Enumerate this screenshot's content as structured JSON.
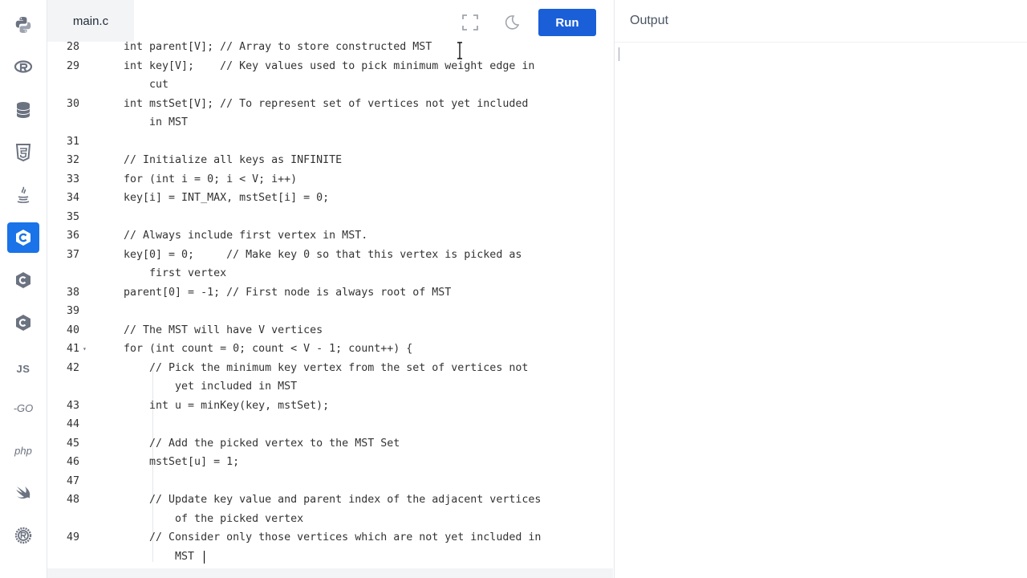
{
  "sidebar": {
    "items": [
      {
        "name": "python-icon",
        "label": ""
      },
      {
        "name": "r-icon",
        "label": ""
      },
      {
        "name": "database-icon",
        "label": ""
      },
      {
        "name": "html5-icon",
        "label": ""
      },
      {
        "name": "java-icon",
        "label": ""
      },
      {
        "name": "c-icon",
        "label": "",
        "active": true
      },
      {
        "name": "cpp-icon",
        "label": ""
      },
      {
        "name": "csharp-icon",
        "label": ""
      },
      {
        "name": "javascript-icon",
        "label": "JS"
      },
      {
        "name": "go-icon",
        "label": "-GO"
      },
      {
        "name": "php-icon",
        "label": "php"
      },
      {
        "name": "swift-icon",
        "label": ""
      },
      {
        "name": "rust-icon",
        "label": ""
      }
    ]
  },
  "editor": {
    "file_tab": "main.c",
    "run_label": "Run",
    "lines": [
      {
        "n": "28",
        "text": "int parent[V]; // Array to store constructed MST"
      },
      {
        "n": "29",
        "text": "int key[V];    // Key values used to pick minimum weight edge in"
      },
      {
        "n": "",
        "text": "    cut"
      },
      {
        "n": "30",
        "text": "int mstSet[V]; // To represent set of vertices not yet included"
      },
      {
        "n": "",
        "text": "    in MST"
      },
      {
        "n": "31",
        "text": ""
      },
      {
        "n": "32",
        "text": "// Initialize all keys as INFINITE"
      },
      {
        "n": "33",
        "text": "for (int i = 0; i < V; i++)"
      },
      {
        "n": "34",
        "text": "key[i] = INT_MAX, mstSet[i] = 0;"
      },
      {
        "n": "35",
        "text": ""
      },
      {
        "n": "36",
        "text": "// Always include first vertex in MST."
      },
      {
        "n": "37",
        "text": "key[0] = 0;     // Make key 0 so that this vertex is picked as"
      },
      {
        "n": "",
        "text": "    first vertex"
      },
      {
        "n": "38",
        "text": "parent[0] = -1; // First node is always root of MST"
      },
      {
        "n": "39",
        "text": ""
      },
      {
        "n": "40",
        "text": "// The MST will have V vertices"
      },
      {
        "n": "41",
        "text": "for (int count = 0; count < V - 1; count++) {"
      },
      {
        "n": "42",
        "text": "    // Pick the minimum key vertex from the set of vertices not"
      },
      {
        "n": "",
        "text": "        yet included in MST"
      },
      {
        "n": "43",
        "text": "    int u = minKey(key, mstSet);"
      },
      {
        "n": "44",
        "text": ""
      },
      {
        "n": "45",
        "text": "    // Add the picked vertex to the MST Set"
      },
      {
        "n": "46",
        "text": "    mstSet[u] = 1;"
      },
      {
        "n": "47",
        "text": ""
      },
      {
        "n": "48",
        "text": "    // Update key value and parent index of the adjacent vertices"
      },
      {
        "n": "",
        "text": "        of the picked vertex"
      },
      {
        "n": "49",
        "text": "    // Consider only those vertices which are not yet included in"
      },
      {
        "n": "",
        "text": "        MST"
      }
    ]
  },
  "output": {
    "title": "Output"
  },
  "colors": {
    "accent": "#1a73e8",
    "run_button": "#1a5fd8"
  }
}
